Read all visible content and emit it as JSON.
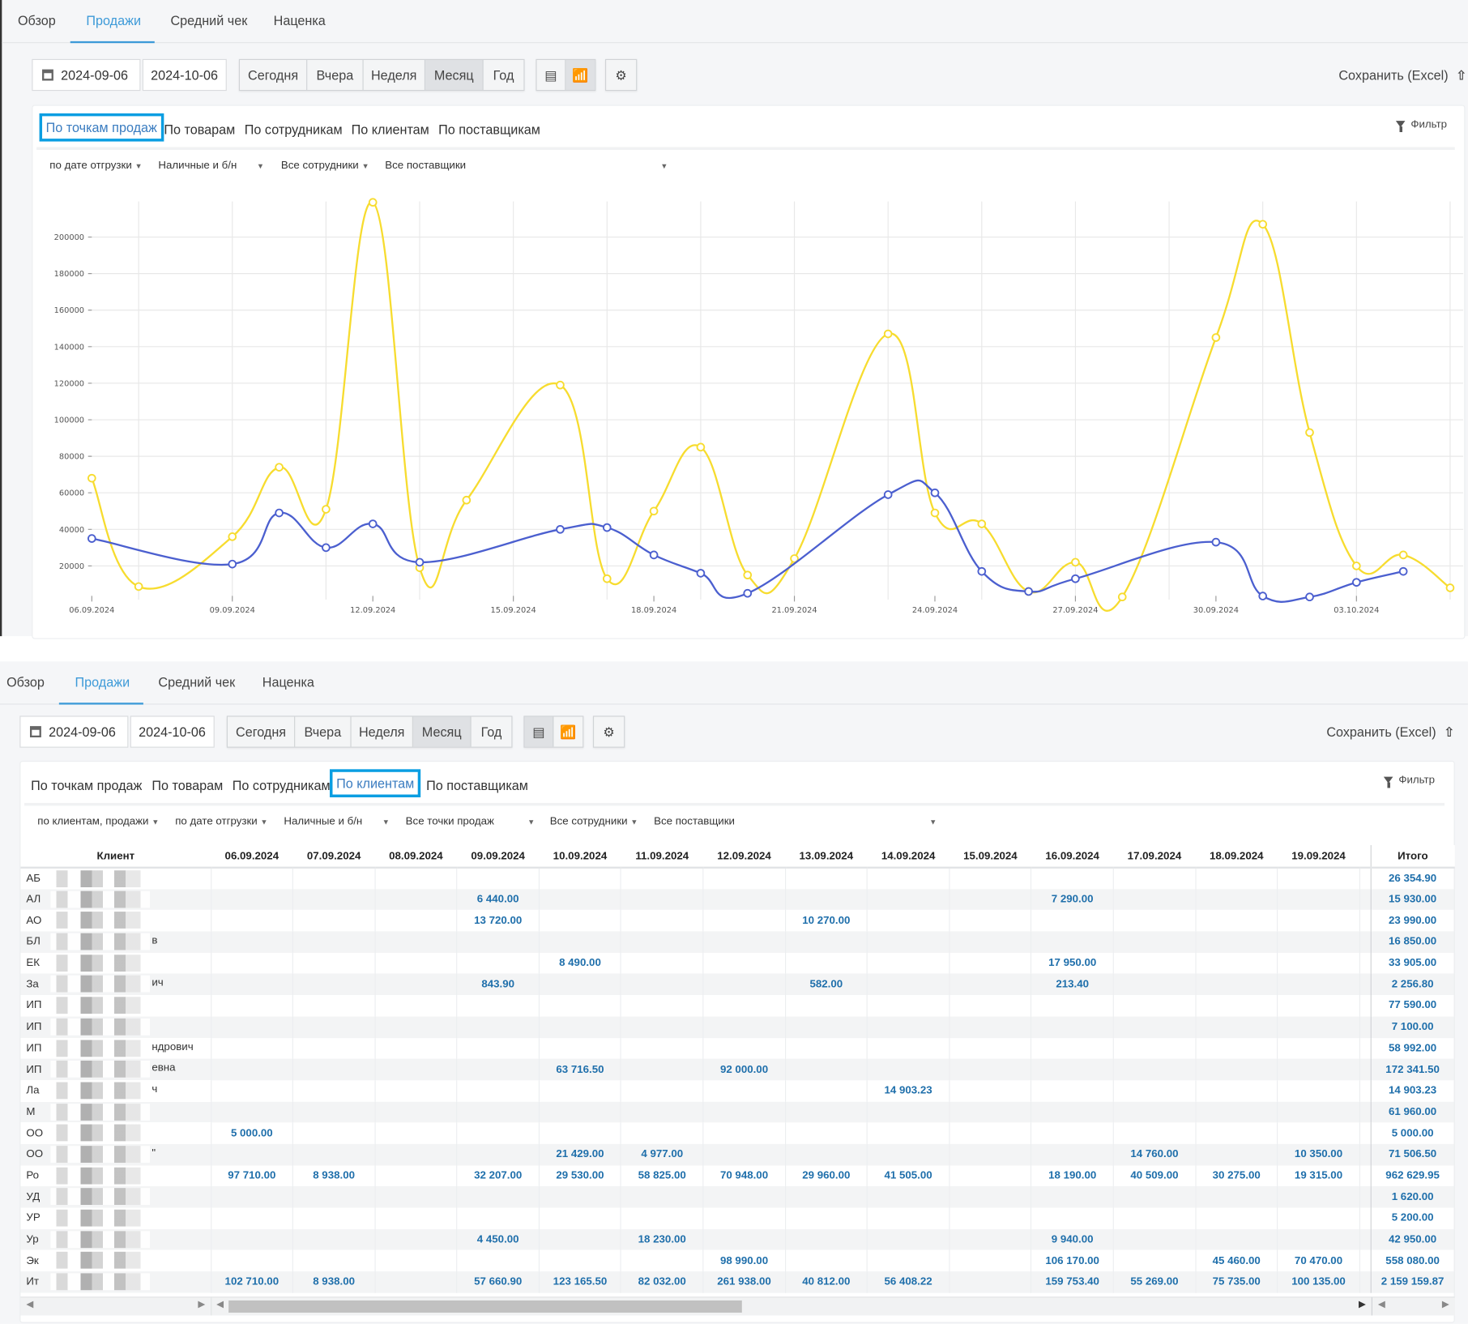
{
  "top_tabs": [
    "Обзор",
    "Продажи",
    "Средний чек",
    "Наценка"
  ],
  "active_tab": "Продажи",
  "toolbar": {
    "date_from": "2024-09-06",
    "date_to": "2024-10-06",
    "periods": [
      "Сегодня",
      "Вчера",
      "Неделя",
      "Месяц",
      "Год"
    ],
    "active_period": "Месяц",
    "view_icons": [
      "table-icon",
      "chart-icon"
    ],
    "settings_icon": "gear-icon",
    "save_label": "Сохранить (Excel)",
    "save_icon": "upload-icon"
  },
  "sub_tabs": [
    "По точкам продаж",
    "По товарам",
    "По сотрудникам",
    "По клиентам",
    "По поставщикам"
  ],
  "filter_label": "Фильтр",
  "chart_panel": {
    "active_subtab": "По точкам продаж",
    "active_view": "chart",
    "filters": [
      "по дате отгрузки",
      "Наличные и б/н",
      "Все сотрудники",
      "Все поставщики"
    ]
  },
  "table_panel": {
    "active_subtab": "По клиентам",
    "active_view": "table",
    "filters": [
      "по клиентам, продажи",
      "по дате отгрузки",
      "Наличные и б/н",
      "Все точки продаж",
      "Все сотрудники",
      "Все поставщики"
    ]
  },
  "chart_data": {
    "type": "line",
    "x_ticks": [
      "06.09.2024",
      "09.09.2024",
      "12.09.2024",
      "15.09.2024",
      "18.09.2024",
      "21.09.2024",
      "24.09.2024",
      "27.09.2024",
      "30.09.2024",
      "03.10.2024"
    ],
    "y_ticks": [
      20000,
      40000,
      60000,
      80000,
      100000,
      120000,
      140000,
      160000,
      180000,
      200000
    ],
    "ylim": [
      0,
      225000
    ],
    "grid": true,
    "x": [
      "06.09",
      "07.09",
      "08.09",
      "09.09",
      "10.09",
      "11.09",
      "12.09",
      "13.09",
      "14.09",
      "15.09",
      "16.09",
      "17.09",
      "18.09",
      "19.09",
      "20.09",
      "21.09",
      "22.09",
      "23.09",
      "24.09",
      "25.09",
      "26.09",
      "27.09",
      "28.09",
      "29.09",
      "30.09",
      "01.10",
      "02.10",
      "03.10",
      "04.10",
      "05.10"
    ],
    "series": [
      {
        "color": "#f7dc2f",
        "values": [
          68000,
          8700,
          null,
          36000,
          74000,
          51000,
          219000,
          19000,
          56000,
          null,
          119000,
          13000,
          50000,
          85000,
          15000,
          24000,
          null,
          147000,
          49000,
          43000,
          6000,
          22000,
          3000,
          null,
          145000,
          207000,
          93000,
          20000,
          26000,
          8000
        ]
      },
      {
        "color": "#4b5fcf",
        "values": [
          35000,
          null,
          null,
          21000,
          49000,
          30000,
          43000,
          22000,
          null,
          null,
          40000,
          41000,
          26000,
          16000,
          5000,
          null,
          null,
          59000,
          60000,
          17000,
          6000,
          13000,
          null,
          null,
          33000,
          3500,
          3000,
          11000,
          17000,
          null
        ]
      }
    ]
  },
  "table": {
    "client_header": "Клиент",
    "total_header": "Итого",
    "date_columns": [
      "06.09.2024",
      "07.09.2024",
      "08.09.2024",
      "09.09.2024",
      "10.09.2024",
      "11.09.2024",
      "12.09.2024",
      "13.09.2024",
      "14.09.2024",
      "15.09.2024",
      "16.09.2024",
      "17.09.2024",
      "18.09.2024",
      "19.09.2024"
    ],
    "rows": [
      {
        "name": "АБ",
        "suffix": "",
        "values": [
          "",
          "",
          "",
          "",
          "",
          "",
          "",
          "",
          "",
          "",
          "",
          "",
          "",
          ""
        ],
        "total": "26 354.90"
      },
      {
        "name": "АЛ",
        "suffix": "",
        "values": [
          "",
          "",
          "",
          "6 440.00",
          "",
          "",
          "",
          "",
          "",
          "",
          "7 290.00",
          "",
          "",
          ""
        ],
        "total": "15 930.00"
      },
      {
        "name": "АО",
        "suffix": "",
        "values": [
          "",
          "",
          "",
          "13 720.00",
          "",
          "",
          "",
          "10 270.00",
          "",
          "",
          "",
          "",
          "",
          ""
        ],
        "total": "23 990.00"
      },
      {
        "name": "БЛ",
        "suffix": "в",
        "values": [
          "",
          "",
          "",
          "",
          "",
          "",
          "",
          "",
          "",
          "",
          "",
          "",
          "",
          ""
        ],
        "total": "16 850.00"
      },
      {
        "name": "ЕК",
        "suffix": "",
        "values": [
          "",
          "",
          "",
          "",
          "8 490.00",
          "",
          "",
          "",
          "",
          "",
          "17 950.00",
          "",
          "",
          ""
        ],
        "total": "33 905.00"
      },
      {
        "name": "За",
        "suffix": "ич",
        "values": [
          "",
          "",
          "",
          "843.90",
          "",
          "",
          "",
          "582.00",
          "",
          "",
          "213.40",
          "",
          "",
          ""
        ],
        "total": "2 256.80"
      },
      {
        "name": "ИП",
        "suffix": "",
        "values": [
          "",
          "",
          "",
          "",
          "",
          "",
          "",
          "",
          "",
          "",
          "",
          "",
          "",
          ""
        ],
        "total": "77 590.00"
      },
      {
        "name": "ИП",
        "suffix": "",
        "values": [
          "",
          "",
          "",
          "",
          "",
          "",
          "",
          "",
          "",
          "",
          "",
          "",
          "",
          ""
        ],
        "total": "7 100.00"
      },
      {
        "name": "ИП",
        "suffix": "ндрович",
        "values": [
          "",
          "",
          "",
          "",
          "",
          "",
          "",
          "",
          "",
          "",
          "",
          "",
          "",
          ""
        ],
        "total": "58 992.00"
      },
      {
        "name": "ИП",
        "suffix": "евна",
        "values": [
          "",
          "",
          "",
          "",
          "63 716.50",
          "",
          "92 000.00",
          "",
          "",
          "",
          "",
          "",
          "",
          ""
        ],
        "total": "172 341.50"
      },
      {
        "name": "Ла",
        "suffix": "ч",
        "values": [
          "",
          "",
          "",
          "",
          "",
          "",
          "",
          "",
          "14 903.23",
          "",
          "",
          "",
          "",
          ""
        ],
        "total": "14 903.23"
      },
      {
        "name": "М",
        "suffix": "",
        "values": [
          "",
          "",
          "",
          "",
          "",
          "",
          "",
          "",
          "",
          "",
          "",
          "",
          "",
          ""
        ],
        "total": "61 960.00"
      },
      {
        "name": "ОО",
        "suffix": "",
        "values": [
          "5 000.00",
          "",
          "",
          "",
          "",
          "",
          "",
          "",
          "",
          "",
          "",
          "",
          "",
          ""
        ],
        "total": "5 000.00"
      },
      {
        "name": "ОО",
        "suffix": "\"",
        "values": [
          "",
          "",
          "",
          "",
          "21 429.00",
          "4 977.00",
          "",
          "",
          "",
          "",
          "",
          "14 760.00",
          "",
          "10 350.00"
        ],
        "total": "71 506.50"
      },
      {
        "name": "Ро",
        "suffix": "",
        "values": [
          "97 710.00",
          "8 938.00",
          "",
          "32 207.00",
          "29 530.00",
          "58 825.00",
          "70 948.00",
          "29 960.00",
          "41 505.00",
          "",
          "18 190.00",
          "40 509.00",
          "30 275.00",
          "19 315.00"
        ],
        "total": "962 629.95"
      },
      {
        "name": "УД",
        "suffix": "",
        "values": [
          "",
          "",
          "",
          "",
          "",
          "",
          "",
          "",
          "",
          "",
          "",
          "",
          "",
          ""
        ],
        "total": "1 620.00"
      },
      {
        "name": "УР",
        "suffix": "",
        "values": [
          "",
          "",
          "",
          "",
          "",
          "",
          "",
          "",
          "",
          "",
          "",
          "",
          "",
          ""
        ],
        "total": "5 200.00"
      },
      {
        "name": "Ур",
        "suffix": "",
        "values": [
          "",
          "",
          "",
          "4 450.00",
          "",
          "18 230.00",
          "",
          "",
          "",
          "",
          "9 940.00",
          "",
          "",
          ""
        ],
        "total": "42 950.00"
      },
      {
        "name": "Эк",
        "suffix": "",
        "values": [
          "",
          "",
          "",
          "",
          "",
          "",
          "98 990.00",
          "",
          "",
          "",
          "106 170.00",
          "",
          "45 460.00",
          "70 470.00"
        ],
        "total": "558 080.00"
      },
      {
        "name": "Ит",
        "suffix": "",
        "values": [
          "102 710.00",
          "8 938.00",
          "",
          "57 660.90",
          "123 165.50",
          "82 032.00",
          "261 938.00",
          "40 812.00",
          "56 408.22",
          "",
          "159 753.40",
          "55 269.00",
          "75 735.00",
          "100 135.00"
        ],
        "total": "2 159 159.87"
      }
    ]
  }
}
